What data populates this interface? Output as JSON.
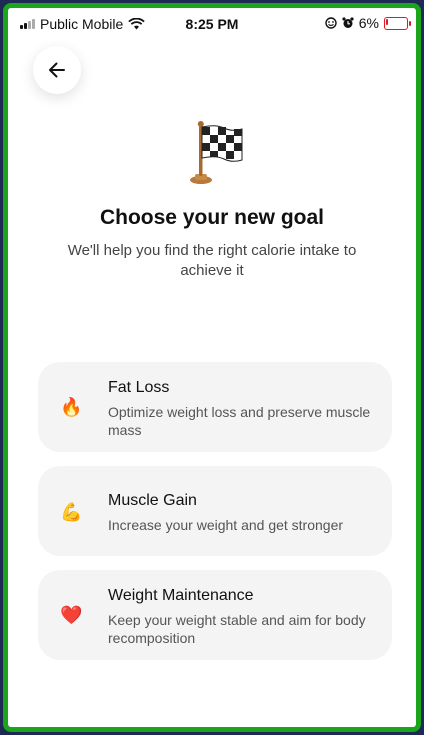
{
  "status_bar": {
    "carrier": "Public Mobile",
    "time": "8:25 PM",
    "battery": "6%"
  },
  "header": {
    "title": "Choose your new goal",
    "subtitle": "We'll help you find the right calorie intake to achieve it"
  },
  "goals": [
    {
      "title": "Fat Loss",
      "description": "Optimize weight loss and preserve muscle mass",
      "icon": "fire-icon",
      "emoji": "🔥"
    },
    {
      "title": "Muscle Gain",
      "description": "Increase your weight and get stronger",
      "icon": "flexed-biceps-icon",
      "emoji": "💪"
    },
    {
      "title": "Weight Maintenance",
      "description": "Keep your weight stable and aim for body recomposition",
      "icon": "heart-icon",
      "emoji": "❤️"
    }
  ],
  "colors": {
    "frame_border": "#1aa51a",
    "card_bg": "#f4f4f4",
    "battery_low": "#e0182a"
  }
}
